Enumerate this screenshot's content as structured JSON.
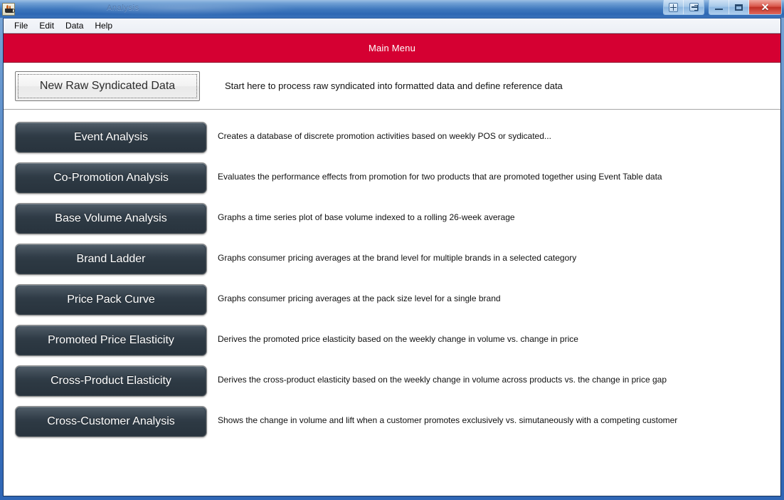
{
  "window": {
    "title": "Analysis",
    "app_icon": "java-coffee-cup-icon",
    "controls": {
      "move": "move-window",
      "restore_group": "restore-down",
      "minimize": "–",
      "maximize": "□",
      "close": "✕"
    }
  },
  "menubar": {
    "items": [
      {
        "label": "File"
      },
      {
        "label": "Edit"
      },
      {
        "label": "Data"
      },
      {
        "label": "Help"
      }
    ]
  },
  "banner": {
    "title": "Main Menu",
    "color": "#d50032"
  },
  "primary_action": {
    "label": "New Raw Syndicated Data",
    "description": "Start here to process raw syndicated into formatted data and define reference data"
  },
  "analysis_rows": [
    {
      "label": "Event Analysis",
      "description": "Creates a database of discrete promotion activities based on weekly POS or sydicated..."
    },
    {
      "label": "Co-Promotion Analysis",
      "description": "Evaluates the performance effects from promotion for two products that are promoted together using Event Table data"
    },
    {
      "label": "Base Volume Analysis",
      "description": "Graphs a time series plot of base volume indexed to a rolling 26-week average"
    },
    {
      "label": "Brand Ladder",
      "description": "Graphs consumer pricing averages at the brand level for multiple brands in a selected category"
    },
    {
      "label": "Price Pack Curve",
      "description": "Graphs consumer pricing averages at the pack size level for a single brand"
    },
    {
      "label": "Promoted Price Elasticity",
      "description": "Derives the promoted price elasticity based on the weekly change in volume vs. change in price"
    },
    {
      "label": "Cross-Product Elasticity",
      "description": "Derives the cross-product elasticity based on the weekly change in volume across products vs. the change in price gap"
    },
    {
      "label": "Cross-Customer Analysis",
      "description": "Shows the change in volume and lift when a customer promotes exclusively vs. simutaneously with a competing customer"
    }
  ],
  "colors": {
    "banner": "#d50032",
    "button_dark": "#2d3943",
    "window_frame": "#2f66b5"
  }
}
